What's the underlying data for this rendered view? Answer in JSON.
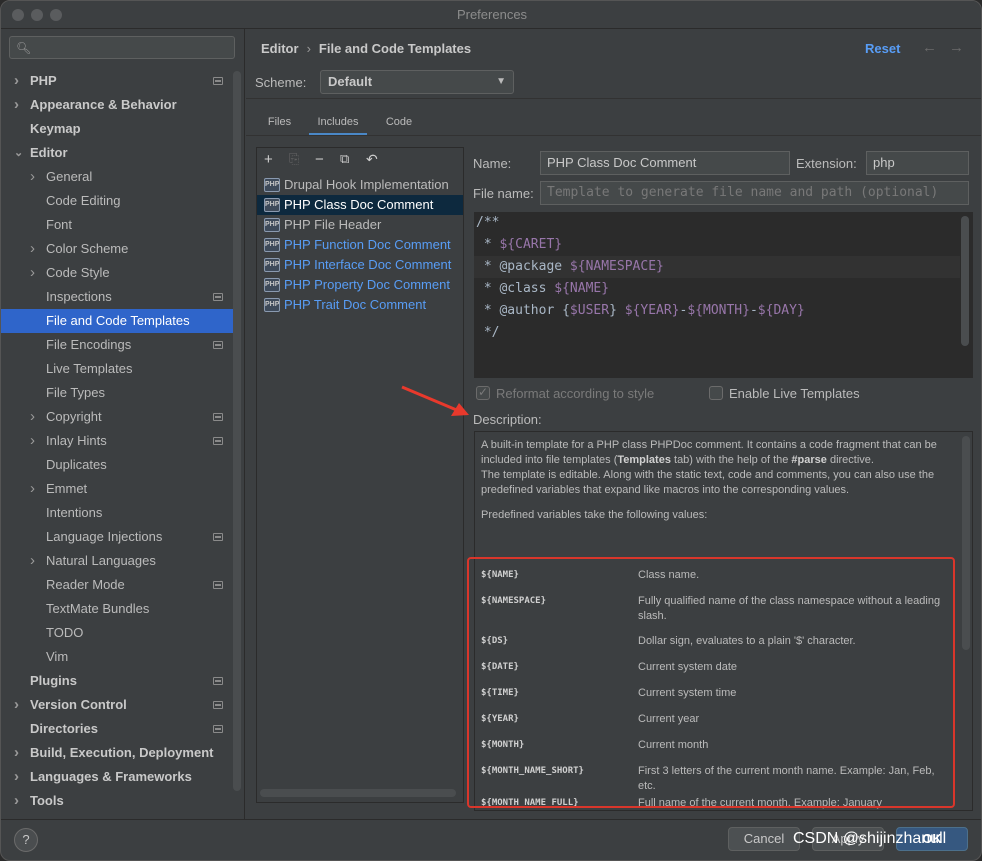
{
  "window": {
    "title": "Preferences"
  },
  "search": {
    "placeholder": ""
  },
  "sidebar": {
    "items": [
      {
        "label": "PHP",
        "level": 0,
        "chevron": true,
        "bold": true,
        "badge": true
      },
      {
        "label": "Appearance & Behavior",
        "level": 0,
        "chevron": true,
        "bold": true,
        "badge": false
      },
      {
        "label": "Keymap",
        "level": 0,
        "chevron": false,
        "bold": true,
        "badge": false
      },
      {
        "label": "Editor",
        "level": 0,
        "chevron": true,
        "expanded": true,
        "bold": true,
        "badge": false
      },
      {
        "label": "General",
        "level": 1,
        "chevron": true,
        "bold": false,
        "badge": false
      },
      {
        "label": "Code Editing",
        "level": 1,
        "chevron": false,
        "bold": false,
        "badge": false
      },
      {
        "label": "Font",
        "level": 1,
        "chevron": false,
        "bold": false,
        "badge": false
      },
      {
        "label": "Color Scheme",
        "level": 1,
        "chevron": true,
        "bold": false,
        "badge": false
      },
      {
        "label": "Code Style",
        "level": 1,
        "chevron": true,
        "bold": false,
        "badge": false
      },
      {
        "label": "Inspections",
        "level": 1,
        "chevron": false,
        "bold": false,
        "badge": true
      },
      {
        "label": "File and Code Templates",
        "level": 1,
        "chevron": false,
        "bold": false,
        "badge": false,
        "selected": true
      },
      {
        "label": "File Encodings",
        "level": 1,
        "chevron": false,
        "bold": false,
        "badge": true
      },
      {
        "label": "Live Templates",
        "level": 1,
        "chevron": false,
        "bold": false,
        "badge": false
      },
      {
        "label": "File Types",
        "level": 1,
        "chevron": false,
        "bold": false,
        "badge": false
      },
      {
        "label": "Copyright",
        "level": 1,
        "chevron": true,
        "bold": false,
        "badge": true
      },
      {
        "label": "Inlay Hints",
        "level": 1,
        "chevron": true,
        "bold": false,
        "badge": true
      },
      {
        "label": "Duplicates",
        "level": 1,
        "chevron": false,
        "bold": false,
        "badge": false
      },
      {
        "label": "Emmet",
        "level": 1,
        "chevron": true,
        "bold": false,
        "badge": false
      },
      {
        "label": "Intentions",
        "level": 1,
        "chevron": false,
        "bold": false,
        "badge": false
      },
      {
        "label": "Language Injections",
        "level": 1,
        "chevron": false,
        "bold": false,
        "badge": true
      },
      {
        "label": "Natural Languages",
        "level": 1,
        "chevron": true,
        "bold": false,
        "badge": false
      },
      {
        "label": "Reader Mode",
        "level": 1,
        "chevron": false,
        "bold": false,
        "badge": true
      },
      {
        "label": "TextMate Bundles",
        "level": 1,
        "chevron": false,
        "bold": false,
        "badge": false
      },
      {
        "label": "TODO",
        "level": 1,
        "chevron": false,
        "bold": false,
        "badge": false
      },
      {
        "label": "Vim",
        "level": 1,
        "chevron": false,
        "bold": false,
        "badge": false
      },
      {
        "label": "Plugins",
        "level": 0,
        "chevron": false,
        "bold": true,
        "badge": true
      },
      {
        "label": "Version Control",
        "level": 0,
        "chevron": true,
        "bold": true,
        "badge": true
      },
      {
        "label": "Directories",
        "level": 0,
        "chevron": false,
        "bold": true,
        "badge": true
      },
      {
        "label": "Build, Execution, Deployment",
        "level": 0,
        "chevron": true,
        "bold": true,
        "badge": false
      },
      {
        "label": "Languages & Frameworks",
        "level": 0,
        "chevron": true,
        "bold": true,
        "badge": false
      },
      {
        "label": "Tools",
        "level": 0,
        "chevron": true,
        "bold": true,
        "badge": false
      }
    ]
  },
  "header": {
    "breadcrumb_parent": "Editor",
    "breadcrumb_current": "File and Code Templates",
    "reset_label": "Reset",
    "back_icon": "arrow-left-icon",
    "forward_icon": "arrow-right-icon"
  },
  "scheme": {
    "label": "Scheme:",
    "value": "Default"
  },
  "tabs": [
    {
      "label": "Files",
      "active": false
    },
    {
      "label": "Includes",
      "active": true
    },
    {
      "label": "Code",
      "active": false
    }
  ],
  "toolbar": {
    "add_icon": "plus-icon",
    "copy_disabled_icon": "copy-template-icon",
    "remove_icon": "minus-icon",
    "duplicate_icon": "duplicate-icon",
    "reset_icon": "undo-icon"
  },
  "templates": [
    {
      "label": "Drupal Hook Implementation",
      "link": false,
      "selected": false
    },
    {
      "label": "PHP Class Doc Comment",
      "link": false,
      "selected": true
    },
    {
      "label": "PHP File Header",
      "link": false,
      "selected": false
    },
    {
      "label": "PHP Function Doc Comment",
      "link": true,
      "selected": false
    },
    {
      "label": "PHP Interface Doc Comment",
      "link": true,
      "selected": false
    },
    {
      "label": "PHP Property Doc Comment",
      "link": true,
      "selected": false
    },
    {
      "label": "PHP Trait Doc Comment",
      "link": true,
      "selected": false
    }
  ],
  "template_icon_text": "PHP",
  "form": {
    "name_label": "Name:",
    "name_value": "PHP Class Doc Comment",
    "extension_label": "Extension:",
    "extension_value": "php",
    "filename_label": "File name:",
    "filename_placeholder": "Template to generate file name and path (optional)"
  },
  "code": {
    "l1": "/**",
    "l2a": " * ",
    "l2b": "${CARET}",
    "l3a": " * @package ",
    "l3b": "${NAMESPACE}",
    "l4a": " * @class ",
    "l4b": "${NAME}",
    "l5a": " * @author {",
    "l5b": "$USER",
    "l5c": "} ",
    "l5d": "${YEAR}",
    "l5e": "-",
    "l5f": "${MONTH}",
    "l5g": "-",
    "l5h": "${DAY}",
    "l6": " */"
  },
  "options": {
    "reformat_label": "Reformat according to style",
    "reformat_checked": true,
    "live_templates_label": "Enable Live Templates",
    "live_templates_checked": false
  },
  "description": {
    "label": "Description:",
    "p1_a": "A built-in template for a PHP class PHPDoc comment. It contains a code fragment that can be included into file templates (",
    "p1_b": "Templates",
    "p1_c": " tab) with the help of the ",
    "p1_d": "#parse",
    "p1_e": " directive.",
    "p2": "The template is editable. Along with the static text, code and comments, you can also use the predefined variables that expand like macros into the corresponding values.",
    "p3": "Predefined variables take the following values:",
    "variables": [
      {
        "name": "${NAME}",
        "desc": "Class name."
      },
      {
        "name": "${NAMESPACE}",
        "desc": "Fully qualified name of the class namespace without a leading slash."
      },
      {
        "name": "${DS}",
        "desc": "Dollar sign, evaluates to a plain '$' character."
      },
      {
        "name": "${DATE}",
        "desc": "Current system date"
      },
      {
        "name": "${TIME}",
        "desc": "Current system time"
      },
      {
        "name": "${YEAR}",
        "desc": "Current year"
      },
      {
        "name": "${MONTH}",
        "desc": "Current month"
      },
      {
        "name": "${MONTH_NAME_SHORT}",
        "desc": "First 3 letters of the current month name. Example: Jan, Feb, etc."
      },
      {
        "name": "${MONTH_NAME_FULL}",
        "desc": "Full name of the current month. Example: January"
      }
    ]
  },
  "annotation": {
    "arrow_color": "#e8392c",
    "box_color": "#d9362b"
  },
  "footer": {
    "help_label": "?",
    "cancel_label": "Cancel",
    "apply_label": "Apply",
    "ok_label": "OK",
    "watermark": "CSDN @shijinzhanull"
  }
}
